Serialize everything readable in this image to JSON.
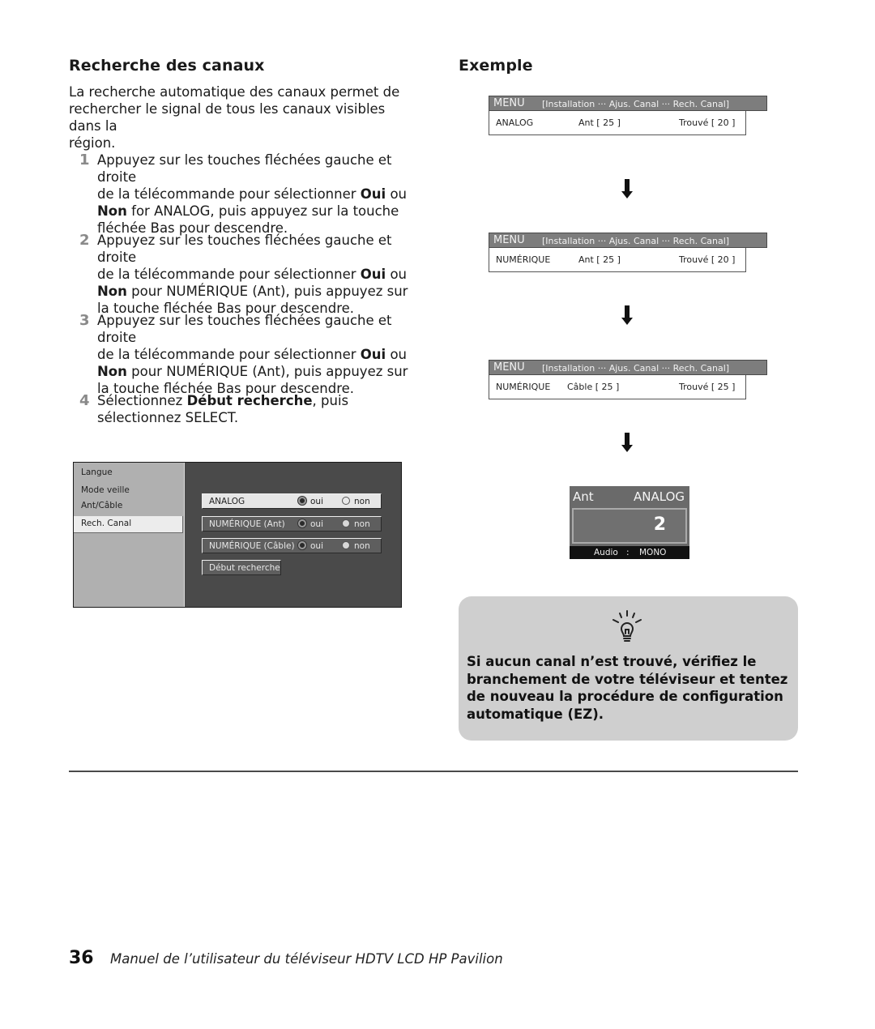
{
  "left": {
    "heading": "Recherche des canaux",
    "intro_lines": [
      "La recherche automatique des canaux permet de",
      "rechercher le signal de tous les canaux visibles dans la",
      "région."
    ],
    "steps": [
      {
        "number": "1",
        "lines": [
          [
            "Appuyez sur les touches fléchées gauche et droite"
          ],
          [
            "de la télécommande pour sélectionner ",
            {
              "b": "Oui"
            },
            " ou"
          ],
          [
            {
              "b": "Non"
            },
            " for ANALOG, puis appuyez sur la touche"
          ],
          [
            "fléchée Bas pour descendre."
          ]
        ]
      },
      {
        "number": "2",
        "lines": [
          [
            "Appuyez sur les touches fléchées gauche et droite"
          ],
          [
            "de la télécommande pour sélectionner ",
            {
              "b": "Oui"
            },
            " ou"
          ],
          [
            {
              "b": "Non"
            },
            " pour NUMÉRIQUE (Ant), puis appuyez sur"
          ],
          [
            "la touche fléchée Bas pour descendre."
          ]
        ]
      },
      {
        "number": "3",
        "lines": [
          [
            "Appuyez sur les touches fléchées gauche et droite"
          ],
          [
            "de la télécommande pour sélectionner ",
            {
              "b": "Oui"
            },
            " ou"
          ],
          [
            {
              "b": "Non"
            },
            " pour NUMÉRIQUE (Ant), puis appuyez sur"
          ],
          [
            "la touche fléchée Bas pour descendre."
          ]
        ]
      },
      {
        "number": "4",
        "lines": [
          [
            "Sélectionnez ",
            {
              "b": "Début recherche"
            },
            ", puis"
          ],
          [
            "sélectionnez SELECT."
          ]
        ]
      }
    ]
  },
  "tv_menu": {
    "sidebar": [
      "Langue",
      "Mode veille",
      "Ant/Câble"
    ],
    "sidebar_selected": "Rech. Canal",
    "options": [
      {
        "label": "ANALOG",
        "yes": "oui",
        "no": "non",
        "selected": "oui",
        "active": true
      },
      {
        "label": "NUMÉRIQUE (Ant)",
        "yes": "oui",
        "no": "non",
        "selected": "oui",
        "active": false
      },
      {
        "label": "NUMÉRIQUE (Câble)",
        "yes": "oui",
        "no": "non",
        "selected": "oui",
        "active": false
      }
    ],
    "start_button": "Début recherche"
  },
  "right": {
    "heading": "Exemple",
    "osd_screens": [
      {
        "menu": "MENU",
        "path": "[Installation ··· Ajus. Canal ··· Rech. Canal]",
        "mode": "ANALOG",
        "source": "Ant [  25 ]",
        "found": "Trouvé [  20 ]"
      },
      {
        "menu": "MENU",
        "path": "[Installation ··· Ajus. Canal ··· Rech. Canal]",
        "mode": "NUMÉRIQUE",
        "source": "Ant [  25 ]",
        "found": "Trouvé [  20 ]"
      },
      {
        "menu": "MENU",
        "path": "[Installation ··· Ajus. Canal ··· Rech. Canal]",
        "mode": "NUMÉRIQUE",
        "source": "Câble [  25 ]",
        "found": "Trouvé [  25 ]"
      }
    ],
    "channel_display": {
      "input": "Ant",
      "mode": "ANALOG",
      "channel": "2",
      "audio_label": "Audio",
      "audio_sep": ":",
      "audio_value": "MONO"
    },
    "tip": {
      "icon": "lightbulb-icon",
      "text": "Si aucun canal n’est trouvé, vérifiez le branchement de votre téléviseur et tentez de nouveau la procédure de configuration automatique (EZ)."
    }
  },
  "footer": {
    "page_number": "36",
    "title": "Manuel de l’utilisateur du téléviseur HDTV LCD HP Pavilion"
  }
}
